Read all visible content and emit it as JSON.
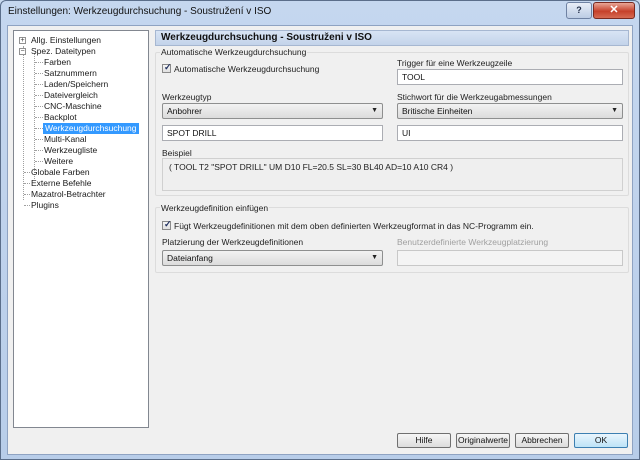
{
  "window": {
    "title": "Einstellungen: Werkzeugdurchsuchung - Soustružení v ISO",
    "help_label": "?",
    "close_label": "✕"
  },
  "tree": {
    "items": [
      {
        "label": "Allg. Einstellungen"
      },
      {
        "label": "Spez. Dateitypen"
      },
      {
        "label": "Farben"
      },
      {
        "label": "Satznummern"
      },
      {
        "label": "Laden/Speichern"
      },
      {
        "label": "Dateivergleich"
      },
      {
        "label": "CNC-Maschine"
      },
      {
        "label": "Backplot"
      },
      {
        "label": "Werkzeugdurchsuchung"
      },
      {
        "label": "Multi-Kanal"
      },
      {
        "label": "Werkzeugliste"
      },
      {
        "label": "Weitere"
      },
      {
        "label": "Globale Farben"
      },
      {
        "label": "Externe Befehle"
      },
      {
        "label": "Mazatrol-Betrachter"
      },
      {
        "label": "Plugins"
      }
    ]
  },
  "panel": {
    "header": "Werkzeugdurchsuchung - Soustruženi v ISO",
    "auto_group_title": "Automatische Werkzeugdurchsuchung",
    "auto_checkbox_label": "Automatische Werkzeugdurchsuchung",
    "auto_checkbox_checked": true,
    "trigger_label": "Trigger für eine Werkzeugzeile",
    "trigger_value": "TOOL",
    "tooltype_label": "Werkzeugtyp",
    "tooltype_value": "Anbohrer",
    "keyword_label": "Stichwort für die Werkzeugabmessungen",
    "keyword_value": "Britische Einheiten",
    "tooltype_text_value": "SPOT DRILL",
    "keyword_text_value": "UI",
    "example_label": "Beispiel",
    "example_value": "( TOOL T2 \"SPOT DRILL\" UM D10 FL=20.5 SL=30 BL40 AD=10 A10 CR4 )",
    "insert_group_title": "Werkzeugdefinition einfügen",
    "insert_checkbox_label": "Fügt Werkzeugdefinitionen mit dem oben definierten Werkzeugformat in das NC-Programm ein.",
    "insert_checkbox_checked": true,
    "placement_label": "Platzierung der Werkzeugdefinitionen",
    "placement_value": "Dateianfang",
    "custom_placement_label": "Benutzerdefinierte Werkzeugplatzierung",
    "custom_placement_value": ""
  },
  "buttons": {
    "help": "Hilfe",
    "defaults": "Originalwerte",
    "cancel": "Abbrechen",
    "ok": "OK"
  }
}
